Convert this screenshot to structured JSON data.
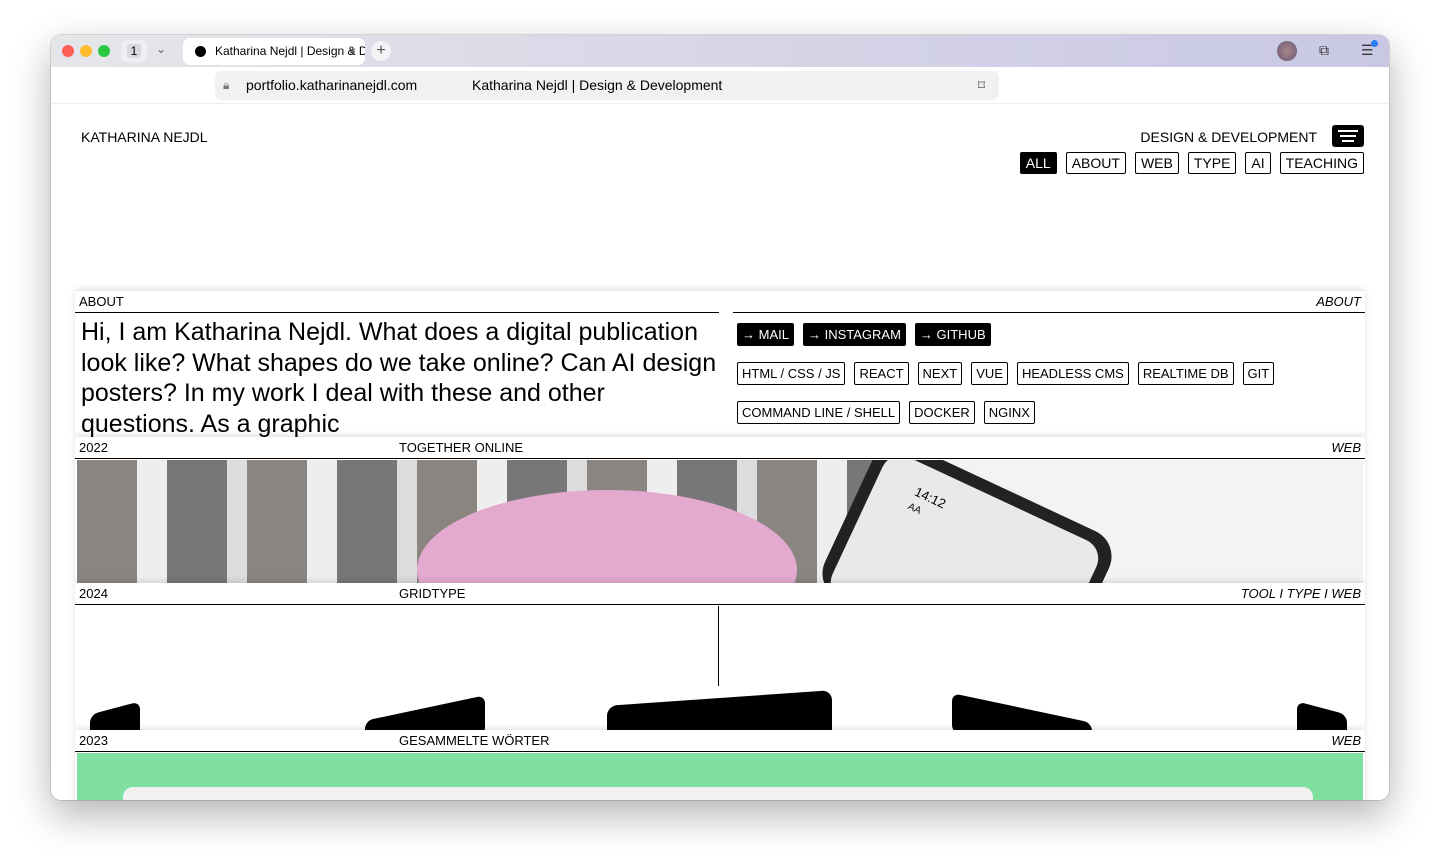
{
  "browser": {
    "tab_count": "1",
    "tab_title": "Katharina Nejdl | Design & Development",
    "url": "portfolio.katharinanejdl.com",
    "page_title": "Katharina Nejdl | Design & Development"
  },
  "header": {
    "name": "KATHARINA NEJDL",
    "tagline": "DESIGN & DEVELOPMENT",
    "filters": [
      "ALL",
      "ABOUT",
      "WEB",
      "TYPE",
      "AI",
      "TEACHING"
    ]
  },
  "about": {
    "label": "ABOUT",
    "category": "ABOUT",
    "text": "Hi, I am Katharina Nejdl. What does a digital publication look like? What shapes do we take online? Can AI design posters? In my work I deal with these and other questions. As a graphic",
    "links": [
      "→ MAIL",
      "→ INSTAGRAM",
      "→ GITHUB"
    ],
    "skills": [
      "HTML / CSS / JS",
      "REACT",
      "NEXT",
      "VUE",
      "HEADLESS CMS",
      "REALTIME DB",
      "GIT",
      "COMMAND LINE / SHELL",
      "DOCKER",
      "NGINX"
    ]
  },
  "projects": [
    {
      "year": "2022",
      "title": "TOGETHER ONLINE",
      "category": "WEB",
      "phone_time": "14:12",
      "phone_label": "AA"
    },
    {
      "year": "2024",
      "title": "GRIDTYPE",
      "category": "TOOL I TYPE I WEB"
    },
    {
      "year": "2023",
      "title": "GESAMMELTE WÖRTER",
      "category": "WEB"
    }
  ]
}
